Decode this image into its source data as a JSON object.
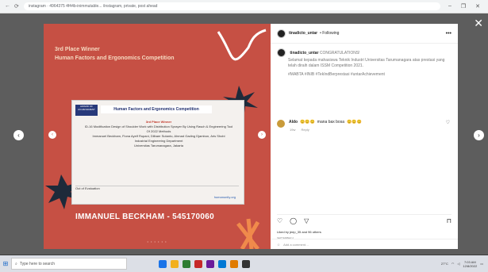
{
  "browser": {
    "nav_back": "←",
    "nav_reload": "⟳",
    "url": "instagram · 4964375 4f44b-inimmutable... /instagram, private, post ahead",
    "win_min": "–",
    "win_max": "❐",
    "win_close": "✕"
  },
  "overlay": {
    "close": "✕",
    "prev": "‹",
    "next": "›"
  },
  "post": {
    "media": {
      "heading1": "3rd Place Winner",
      "heading2": "Human Factors and Ergonomics Competition",
      "poster_award": "AWARD OF ACHIEVEMENT",
      "poster_title": "Human Factors and Ergonomics Competition",
      "poster_place": "3rd Place Winner",
      "poster_project": "ID-16 Modification Design of Shoulder Work with Distribution Sprayer By Using Rasch & Engineering Tool Of 2022 Methods",
      "poster_team": "Immanuel Beckham, Fiona Ayelf Rupani, Dilbaer Sutanto, Ahmad Gading Djambon, Aris Shobi",
      "poster_dept": "Industrial Engineering Department",
      "poster_univ": "Universitas Tarumanagara, Jakarta",
      "poster_footer_label": "Out of Evaluation",
      "poster_footer_link": "humanunity.org",
      "name_bar": "IMMANUEL BECKHAM - 545170060",
      "dots": "• • • • • •",
      "slide_prev": "‹",
      "slide_next": "›"
    },
    "header": {
      "username": "tinadicto_untar",
      "follow": "• Following",
      "more": "•••"
    },
    "caption": {
      "username": "tinadicto_untar",
      "lead": "CONGRATULATIONS!",
      "body": "Selamat kepada mahasiswa Teknik Industri Universitas Tarumanagara atas prestasi yang telah diraih dalam ISSM Competition 2021.",
      "tags": "#MABTA #INIB #TekIndBerprestasi #untarAchievement"
    },
    "comment": {
      "username": "Aldo",
      "emoji": "😊😊😊",
      "text": "mana bax bosa",
      "emoji_end": "😊😊😊",
      "age": "19w",
      "reply": "Reply",
      "heart": "♡"
    },
    "actions": {
      "like": "♡",
      "comment": "◯",
      "share": "▽",
      "save": "⊓"
    },
    "likes": "Liked by jeep_35 and 96 others",
    "date": "SEPTEMBER 2",
    "add_comment": "Add a comment…",
    "emoji_picker": "☺"
  },
  "taskbar": {
    "start": "⊞",
    "search_placeholder": "Type here to search",
    "clock_time": "7:03 AM",
    "clock_date": "12/8/2022",
    "tray_text": "27°C",
    "icon_colors": [
      "#1a73e8",
      "#f2b01e",
      "#2e7d32",
      "#c62828",
      "#6a1b9a",
      "#0078d4",
      "#e07b00",
      "#333333"
    ]
  }
}
